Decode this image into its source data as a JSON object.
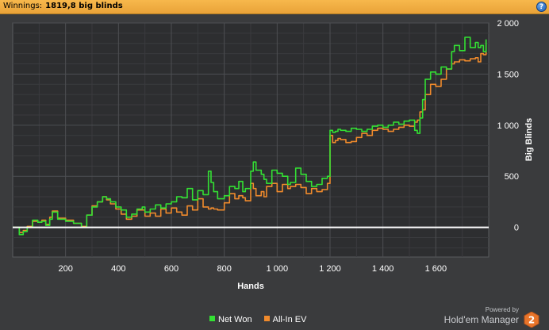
{
  "header": {
    "label": "Winnings:",
    "value": "1819,8 big blinds",
    "help": "?"
  },
  "brand": {
    "powered_by": "Powered by",
    "name": "Hold'em Manager",
    "logo_text": "2"
  },
  "colors": {
    "net_won": "#33e033",
    "all_in_ev": "#f08a2c",
    "zero_line": "#ffffff",
    "header": "#f2ad42"
  },
  "chart_data": {
    "type": "line",
    "xlabel": "Hands",
    "ylabel": "Big Blinds",
    "xlim": [
      0,
      1800
    ],
    "ylim": [
      -290,
      2000
    ],
    "x_ticks": [
      200,
      400,
      600,
      800,
      1000,
      1200,
      1400,
      1600
    ],
    "x_tick_labels": [
      "200",
      "400",
      "600",
      "800",
      "1 000",
      "1 200",
      "1 400",
      "1 600"
    ],
    "y_ticks": [
      0,
      500,
      1000,
      1500,
      2000
    ],
    "y_tick_labels": [
      "0",
      "500",
      "1 000",
      "1 500",
      "2 000"
    ],
    "grid": true,
    "legend_position": "bottom-center",
    "series": [
      {
        "name": "Net Won",
        "color": "#33e033",
        "x": [
          0,
          25,
          40,
          55,
          75,
          95,
          110,
          125,
          140,
          150,
          170,
          200,
          230,
          260,
          280,
          300,
          320,
          340,
          355,
          370,
          390,
          410,
          430,
          450,
          470,
          490,
          500,
          520,
          540,
          560,
          580,
          600,
          620,
          640,
          660,
          680,
          700,
          720,
          740,
          750,
          760,
          775,
          800,
          820,
          840,
          855,
          870,
          880,
          900,
          910,
          920,
          940,
          950,
          960,
          980,
          1000,
          1020,
          1040,
          1050,
          1070,
          1090,
          1110,
          1130,
          1150,
          1170,
          1190,
          1200,
          1210,
          1220,
          1230,
          1240,
          1260,
          1280,
          1300,
          1320,
          1340,
          1360,
          1380,
          1400,
          1420,
          1440,
          1460,
          1480,
          1500,
          1520,
          1530,
          1540,
          1550,
          1560,
          1580,
          1600,
          1620,
          1640,
          1660,
          1670,
          1690,
          1710,
          1730,
          1750,
          1760,
          1770,
          1780,
          1790
        ],
        "values": [
          0,
          -70,
          -40,
          0,
          70,
          50,
          60,
          20,
          80,
          150,
          80,
          60,
          40,
          0,
          120,
          200,
          250,
          300,
          280,
          250,
          200,
          170,
          100,
          130,
          180,
          200,
          150,
          180,
          220,
          190,
          230,
          250,
          300,
          290,
          380,
          270,
          360,
          320,
          550,
          440,
          350,
          280,
          310,
          400,
          380,
          450,
          350,
          380,
          550,
          640,
          560,
          520,
          470,
          430,
          560,
          530,
          500,
          420,
          440,
          580,
          520,
          450,
          400,
          420,
          480,
          500,
          950,
          930,
          940,
          960,
          950,
          940,
          970,
          960,
          940,
          960,
          990,
          1000,
          980,
          1000,
          1030,
          1010,
          1040,
          1050,
          950,
          920,
          1070,
          1250,
          1450,
          1520,
          1500,
          1570,
          1550,
          1720,
          1780,
          1730,
          1860,
          1760,
          1810,
          1760,
          1780,
          1720,
          1840
        ]
      },
      {
        "name": "All-In EV",
        "color": "#f08a2c",
        "x": [
          0,
          25,
          40,
          55,
          75,
          95,
          110,
          125,
          140,
          150,
          170,
          200,
          230,
          260,
          280,
          300,
          320,
          340,
          355,
          370,
          390,
          410,
          430,
          450,
          470,
          490,
          500,
          520,
          540,
          560,
          580,
          600,
          620,
          640,
          660,
          680,
          700,
          720,
          740,
          750,
          760,
          775,
          800,
          820,
          840,
          855,
          870,
          880,
          900,
          910,
          920,
          940,
          950,
          960,
          980,
          1000,
          1020,
          1040,
          1050,
          1070,
          1090,
          1110,
          1130,
          1150,
          1170,
          1190,
          1200,
          1210,
          1220,
          1230,
          1240,
          1260,
          1280,
          1300,
          1320,
          1340,
          1360,
          1380,
          1400,
          1420,
          1440,
          1460,
          1480,
          1500,
          1520,
          1530,
          1540,
          1550,
          1560,
          1580,
          1600,
          1620,
          1640,
          1660,
          1670,
          1690,
          1710,
          1730,
          1750,
          1760,
          1770,
          1780,
          1790
        ],
        "values": [
          0,
          -50,
          -30,
          10,
          60,
          50,
          70,
          30,
          100,
          160,
          90,
          70,
          40,
          10,
          120,
          210,
          250,
          300,
          270,
          230,
          180,
          130,
          80,
          110,
          170,
          170,
          110,
          140,
          110,
          180,
          140,
          190,
          150,
          120,
          210,
          170,
          280,
          200,
          180,
          190,
          180,
          170,
          240,
          330,
          280,
          310,
          290,
          260,
          430,
          380,
          310,
          350,
          300,
          400,
          430,
          350,
          420,
          380,
          400,
          420,
          390,
          330,
          380,
          350,
          370,
          430,
          900,
          830,
          850,
          870,
          860,
          830,
          840,
          880,
          920,
          900,
          950,
          970,
          960,
          940,
          960,
          980,
          1000,
          990,
          1030,
          1050,
          1130,
          1150,
          1300,
          1400,
          1380,
          1450,
          1550,
          1600,
          1620,
          1640,
          1630,
          1650,
          1660,
          1620,
          1700,
          1690,
          1820
        ]
      }
    ]
  }
}
